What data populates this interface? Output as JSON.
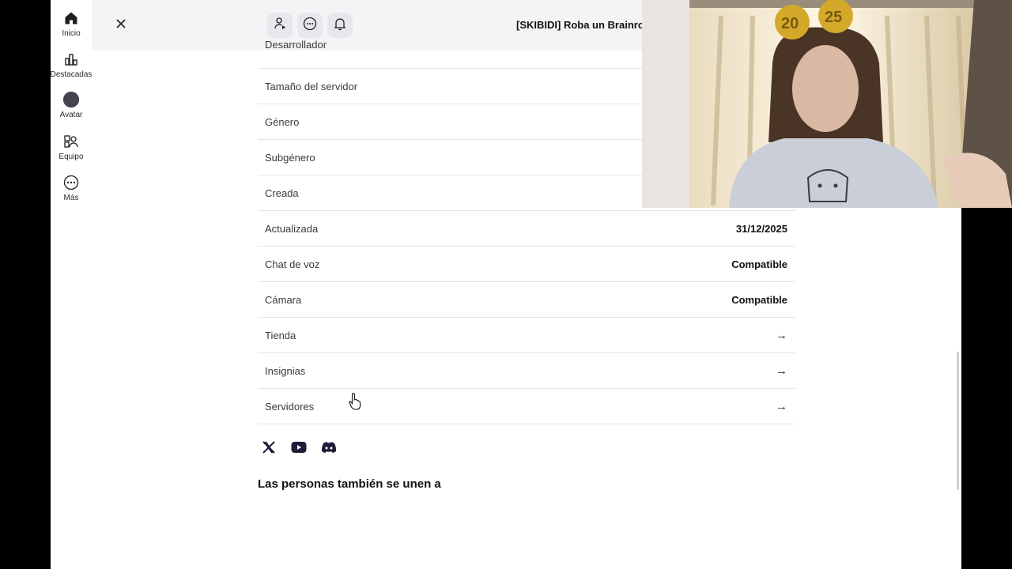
{
  "rail": {
    "items": [
      {
        "label": "Inicio",
        "icon": "home-icon"
      },
      {
        "label": "Destacadas",
        "icon": "chart-icon"
      },
      {
        "label": "Avatar",
        "icon": "avatar-icon"
      },
      {
        "label": "Equipo",
        "icon": "team-icon"
      },
      {
        "label": "Más",
        "icon": "more-icon"
      }
    ]
  },
  "topbar": {
    "title": "[SKIBIDI] Roba un Brainrot"
  },
  "info": {
    "partial_row": "Desarrollador",
    "rows": [
      {
        "label": "Tamaño del servidor",
        "value": ""
      },
      {
        "label": "Género",
        "value": ""
      },
      {
        "label": "Subgénero",
        "value": ""
      },
      {
        "label": "Creada",
        "value": ""
      },
      {
        "label": "Actualizada",
        "value": "31/12/2025"
      },
      {
        "label": "Chat de voz",
        "value": "Compatible"
      },
      {
        "label": "Cámara",
        "value": "Compatible"
      },
      {
        "label": "Tienda",
        "value": "→"
      },
      {
        "label": "Insignias",
        "value": "→"
      },
      {
        "label": "Servidores",
        "value": "→"
      }
    ]
  },
  "socials": [
    "x-icon",
    "youtube-icon",
    "discord-icon"
  ],
  "section": {
    "also_join": "Las personas también se unen a"
  },
  "colors": {
    "accent": "#1f1f22",
    "topbar_bg": "#f4f4f6",
    "divider": "#e4e4e8"
  }
}
